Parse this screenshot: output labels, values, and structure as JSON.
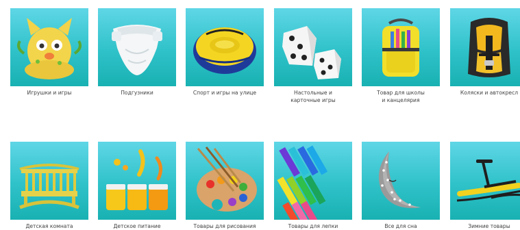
{
  "categories": [
    {
      "label": "Игрушки и игры",
      "icon": "plush-cat-toy-icon"
    },
    {
      "label": "Подгузники",
      "icon": "diaper-icon"
    },
    {
      "label": "Спорт и игры на улице",
      "icon": "snow-tube-icon"
    },
    {
      "label": "Настольные и\nкарточные игры",
      "icon": "dice-icon"
    },
    {
      "label": "Товар для школы\nи канцелярия",
      "icon": "school-backpack-icon"
    },
    {
      "label": "Коляски и автокресл",
      "icon": "car-seat-icon"
    },
    {
      "label": "Детская комната",
      "icon": "crib-icon"
    },
    {
      "label": "Детское питание",
      "icon": "baby-food-jars-icon"
    },
    {
      "label": "Товары для рисования",
      "icon": "paint-palette-icon"
    },
    {
      "label": "Товары для лепки",
      "icon": "modeling-clay-icon"
    },
    {
      "label": "Все для сна",
      "icon": "moon-pillow-icon"
    },
    {
      "label": "Зимние товары",
      "icon": "snow-scooter-icon"
    }
  ]
}
